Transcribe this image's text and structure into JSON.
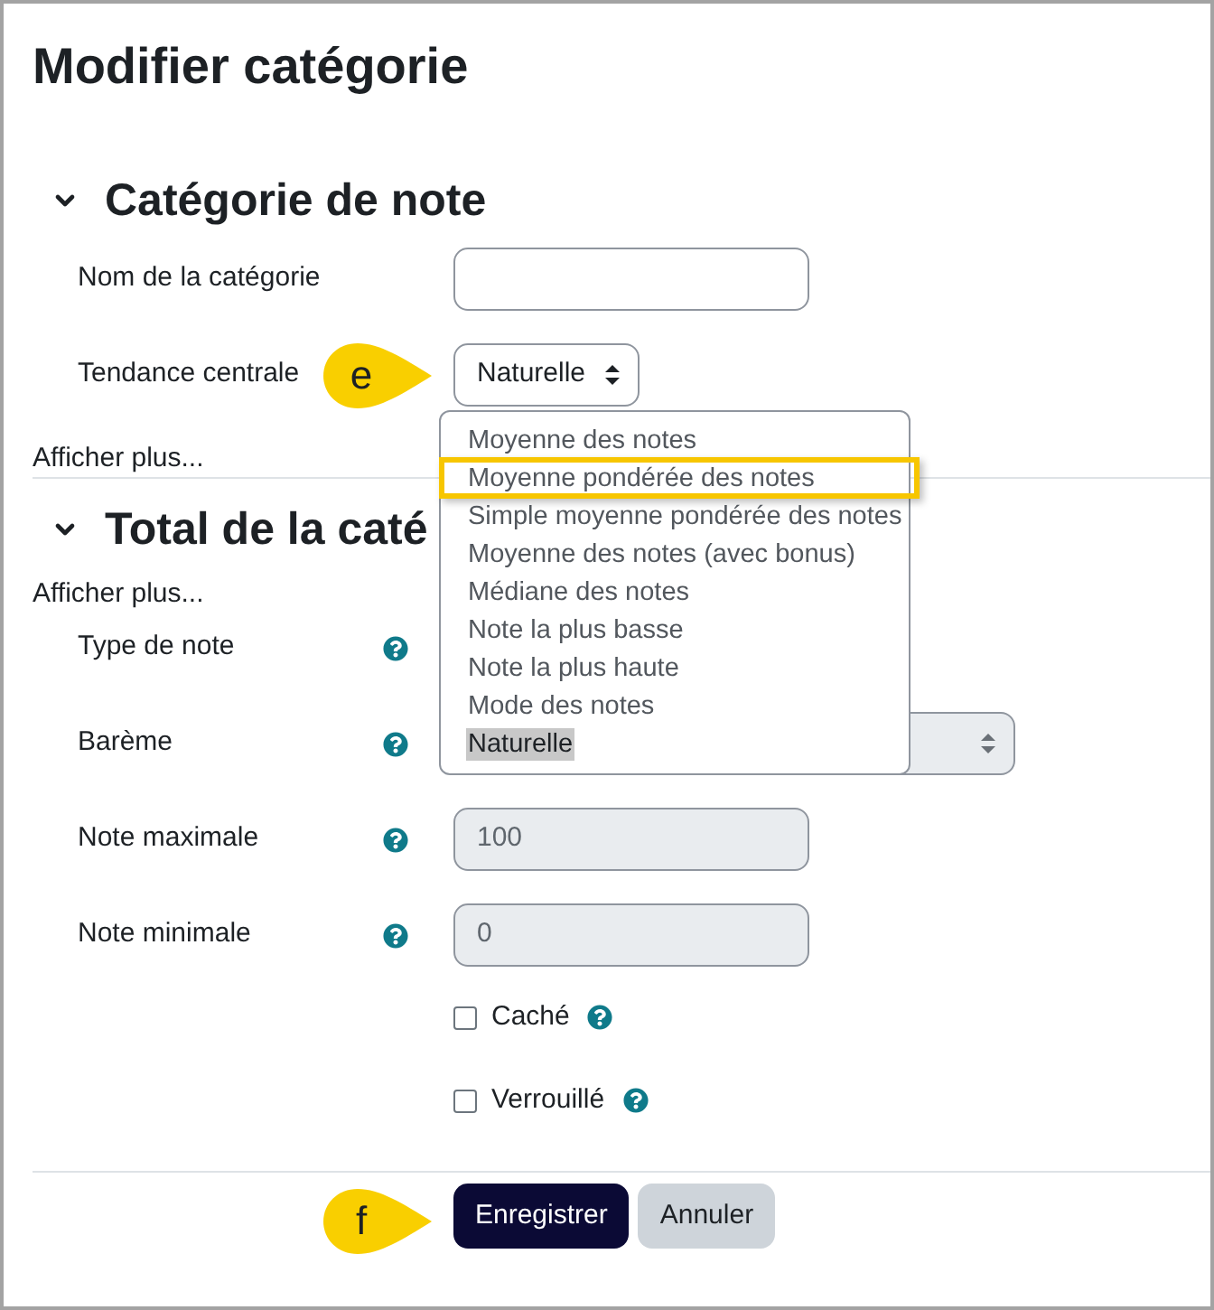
{
  "page": {
    "title": "Modifier catégorie"
  },
  "sections": [
    {
      "title": "Catégorie de note",
      "expanded": true,
      "items": [
        {
          "kind": "text",
          "label": "Nom de la catégorie",
          "help": false,
          "disabled": false
        },
        {
          "kind": "select",
          "label": "Tendance centrale",
          "help": false,
          "disabled": false,
          "value": "Naturelle",
          "callout": "e",
          "open": true,
          "options": [
            {
              "label": "Moyenne des notes",
              "selected": false,
              "highlighted": false
            },
            {
              "label": "Moyenne pondérée des notes",
              "selected": false,
              "highlighted": true
            },
            {
              "label": "Simple moyenne pondérée des notes",
              "selected": false,
              "highlighted": false
            },
            {
              "label": "Moyenne des notes (avec bonus)",
              "selected": false,
              "highlighted": false
            },
            {
              "label": "Médiane des notes",
              "selected": false,
              "highlighted": false
            },
            {
              "label": "Note la plus basse",
              "selected": false,
              "highlighted": false
            },
            {
              "label": "Note la plus haute",
              "selected": false,
              "highlighted": false
            },
            {
              "label": "Mode des notes",
              "selected": false,
              "highlighted": false
            },
            {
              "label": "Naturelle",
              "selected": true,
              "highlighted": false
            }
          ]
        },
        {
          "kind": "link",
          "label": "Afficher plus..."
        }
      ]
    },
    {
      "title": "Total de la caté",
      "expanded": true,
      "items": [
        {
          "kind": "link",
          "label": "Afficher plus..."
        },
        {
          "kind": "plain",
          "label": "Type de note",
          "help": true
        },
        {
          "kind": "select",
          "label": "Barème",
          "help": true,
          "disabled": true,
          "open": false
        },
        {
          "kind": "text",
          "label": "Note maximale",
          "help": true,
          "disabled": true,
          "value": "100"
        },
        {
          "kind": "text",
          "label": "Note minimale",
          "help": true,
          "disabled": true,
          "value": "0"
        },
        {
          "kind": "checkbox",
          "label": "Caché",
          "help": true,
          "checked": false
        },
        {
          "kind": "checkbox",
          "label": "Verrouillé",
          "help": true,
          "checked": false
        }
      ]
    }
  ],
  "buttons": [
    {
      "kind": "primary",
      "label": "Enregistrer",
      "callout": "f"
    },
    {
      "kind": "secondary",
      "label": "Annuler"
    }
  ]
}
